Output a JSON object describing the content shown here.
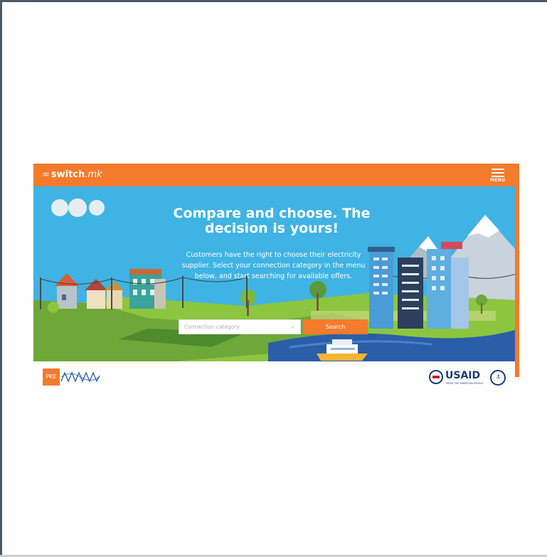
{
  "header": {
    "logo_name": "switch",
    "logo_tld": ".mk",
    "menu_label": "MENU"
  },
  "hero": {
    "title": "Compare and choose. The decision is yours!",
    "subtitle": "Customers have the right to choose their electricity supplier. Select your connection category in the menu below, and start searching for available offers.",
    "select_placeholder": "Connection category",
    "search_label": "Search"
  },
  "partners": {
    "pke_label": "PKE",
    "usaid_label": "USAID",
    "usaid_tagline": "FROM THE AMERICAN PEOPLE"
  },
  "colors": {
    "brand_orange": "#f47a2c",
    "sky": "#3fb3e3",
    "grass": "#8cc63f",
    "river": "#2b5ea8",
    "usaid_blue": "#1a3b78"
  }
}
